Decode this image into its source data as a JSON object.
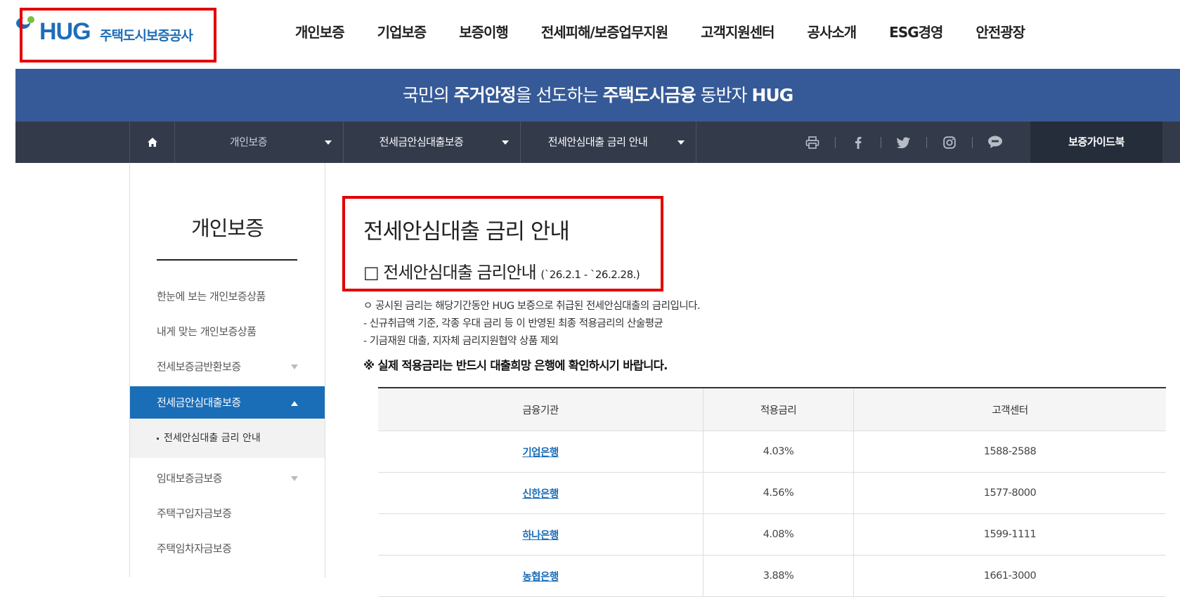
{
  "header": {
    "logo": {
      "brand": "HUG",
      "name": "주택도시보증공사",
      "colors": {
        "blue": "#1e6db8",
        "green": "#7bbf3c"
      }
    },
    "gnb": [
      "개인보증",
      "기업보증",
      "보증이행",
      "전세피해/보증업무지원",
      "고객지원센터",
      "공사소개",
      "ESG경영",
      "안전광장"
    ]
  },
  "banner": {
    "part1": "국민의 ",
    "bold1": "주거안정",
    "part2": "을 선도하는 ",
    "bold2": "주택도시금융",
    "part3": " 동반자 ",
    "bold3": "HUG",
    "bg_color": "#365a97"
  },
  "location": {
    "home_icon": "home-icon",
    "dropdowns": [
      "개인보증",
      "전세금안심대출보증",
      "전세안심대출 금리 안내"
    ],
    "sns_icons": [
      "print-icon",
      "facebook-icon",
      "twitter-icon",
      "instagram-icon",
      "kakaotalk-icon"
    ],
    "guide_button": "보증가이드북"
  },
  "sidebar": {
    "title": "개인보증",
    "items": [
      {
        "label": "한눈에 보는 개인보증상품",
        "expandable": false
      },
      {
        "label": "내게 맞는 개인보증상품",
        "expandable": false
      },
      {
        "label": "전세보증금반환보증",
        "expandable": true
      },
      {
        "label": "전세금안심대출보증",
        "expandable": true,
        "active": true
      },
      {
        "label": "임대보증금보증",
        "expandable": true
      },
      {
        "label": "주택구입자금보증",
        "expandable": false
      },
      {
        "label": "주택임차자금보증",
        "expandable": false
      }
    ],
    "sub_item": "전세안심대출 금리 안내",
    "accent_color": "#1a6db7"
  },
  "content": {
    "title": "전세안심대출 금리 안내",
    "subtitle": "□ 전세안심대출 금리안내",
    "period": "(`26.2.1 - `26.2.28.)",
    "notes": [
      "ㅇ 공시된 금리는 해당기간동안 HUG 보증으로 취급된 전세안심대출의 금리입니다.",
      "- 신규취급액 기준, 각종 우대 금리 등 이 반영된 최종 적용금리의 산술평균",
      "- 기금재원 대출, 지자체 금리지원협약 상품 제외"
    ],
    "warning": "※ 실제 적용금리는 반드시 대출희망 은행에 확인하시기 바랍니다."
  },
  "rates_table": {
    "headers": [
      "금융기관",
      "적용금리",
      "고객센터"
    ],
    "rows": [
      {
        "bank": "기업은행",
        "rate": "4.03%",
        "phone": "1588-2588"
      },
      {
        "bank": "신한은행",
        "rate": "4.56%",
        "phone": "1577-8000"
      },
      {
        "bank": "하나은행",
        "rate": "4.08%",
        "phone": "1599-1111"
      },
      {
        "bank": "농협은행",
        "rate": "3.88%",
        "phone": "1661-3000"
      }
    ]
  }
}
